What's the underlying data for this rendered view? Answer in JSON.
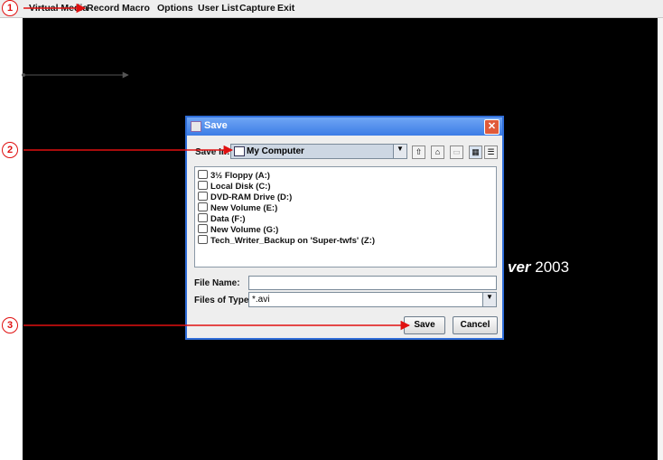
{
  "menubar": {
    "items": [
      "Virtual Media",
      "Record",
      "Macro",
      "Options",
      "User List",
      "Capture",
      "Exit"
    ]
  },
  "background": {
    "text_bold": "ver",
    "text_regular": "2003"
  },
  "dialog": {
    "title": "Save",
    "save_in_label": "Save In:",
    "save_in_value": "My Computer",
    "toolbar_icons": [
      "up-folder-icon",
      "home-icon",
      "new-folder-icon",
      "list-view-icon",
      "details-view-icon"
    ],
    "files": [
      {
        "name": "3½ Floppy (A:)",
        "icon": "floppy-icon"
      },
      {
        "name": "Local Disk (C:)",
        "icon": "disk-icon"
      },
      {
        "name": "DVD-RAM Drive (D:)",
        "icon": "disk-icon"
      },
      {
        "name": "New Volume (E:)",
        "icon": "disk-icon"
      },
      {
        "name": "Data (F:)",
        "icon": "disk-icon"
      },
      {
        "name": "New Volume (G:)",
        "icon": "disk-icon"
      },
      {
        "name": "Tech_Writer_Backup on 'Super-twfs' (Z:)",
        "icon": "network-disk-icon"
      }
    ],
    "file_name_label": "File Name:",
    "file_name_value": "",
    "files_of_type_label": "Files of Type:",
    "files_of_type_value": "*.avi",
    "save_button": "Save",
    "cancel_button": "Cancel"
  },
  "annotations": {
    "callout_1": "1",
    "callout_2": "2",
    "callout_3": "3",
    "color": "#e01010"
  }
}
